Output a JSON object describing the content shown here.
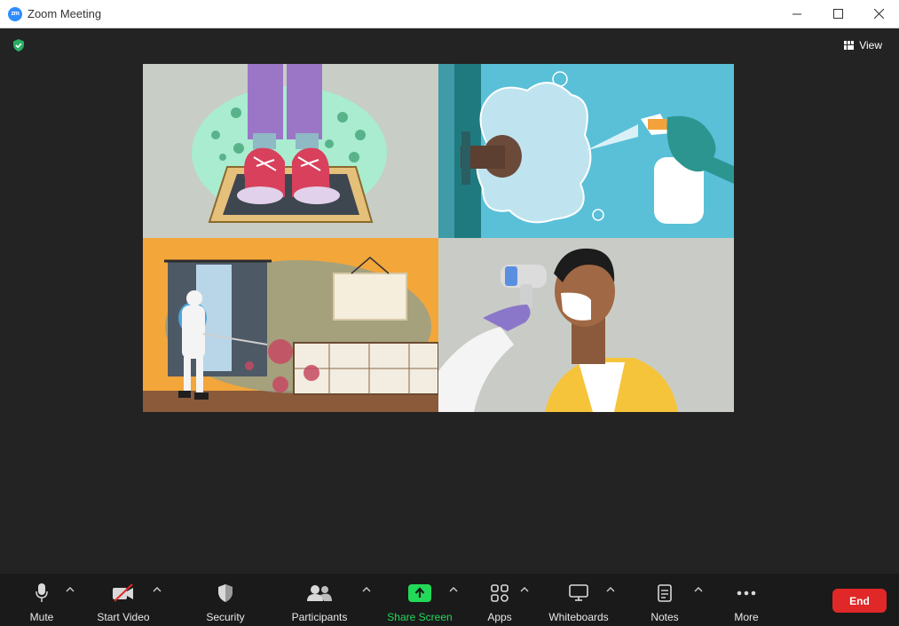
{
  "window": {
    "title": "Zoom Meeting",
    "logo_text": "zm"
  },
  "meeting": {
    "view_label": "View",
    "accent_color": "#2d8cff",
    "secure_color": "#27ae60",
    "participant_tiles": [
      {
        "scene": "shoes-on-disinfecting-doormat"
      },
      {
        "scene": "spraying-door-handle"
      },
      {
        "scene": "disinfection-worker-spraying-room"
      },
      {
        "scene": "temperature-check-man-with-mask"
      }
    ]
  },
  "toolbar": {
    "mute": "Mute",
    "start_video": "Start Video",
    "security": "Security",
    "participants": "Participants",
    "share_screen": "Share Screen",
    "apps": "Apps",
    "whiteboards": "Whiteboards",
    "notes": "Notes",
    "more": "More",
    "end": "End",
    "share_color": "#23d959",
    "end_color": "#e02828"
  }
}
